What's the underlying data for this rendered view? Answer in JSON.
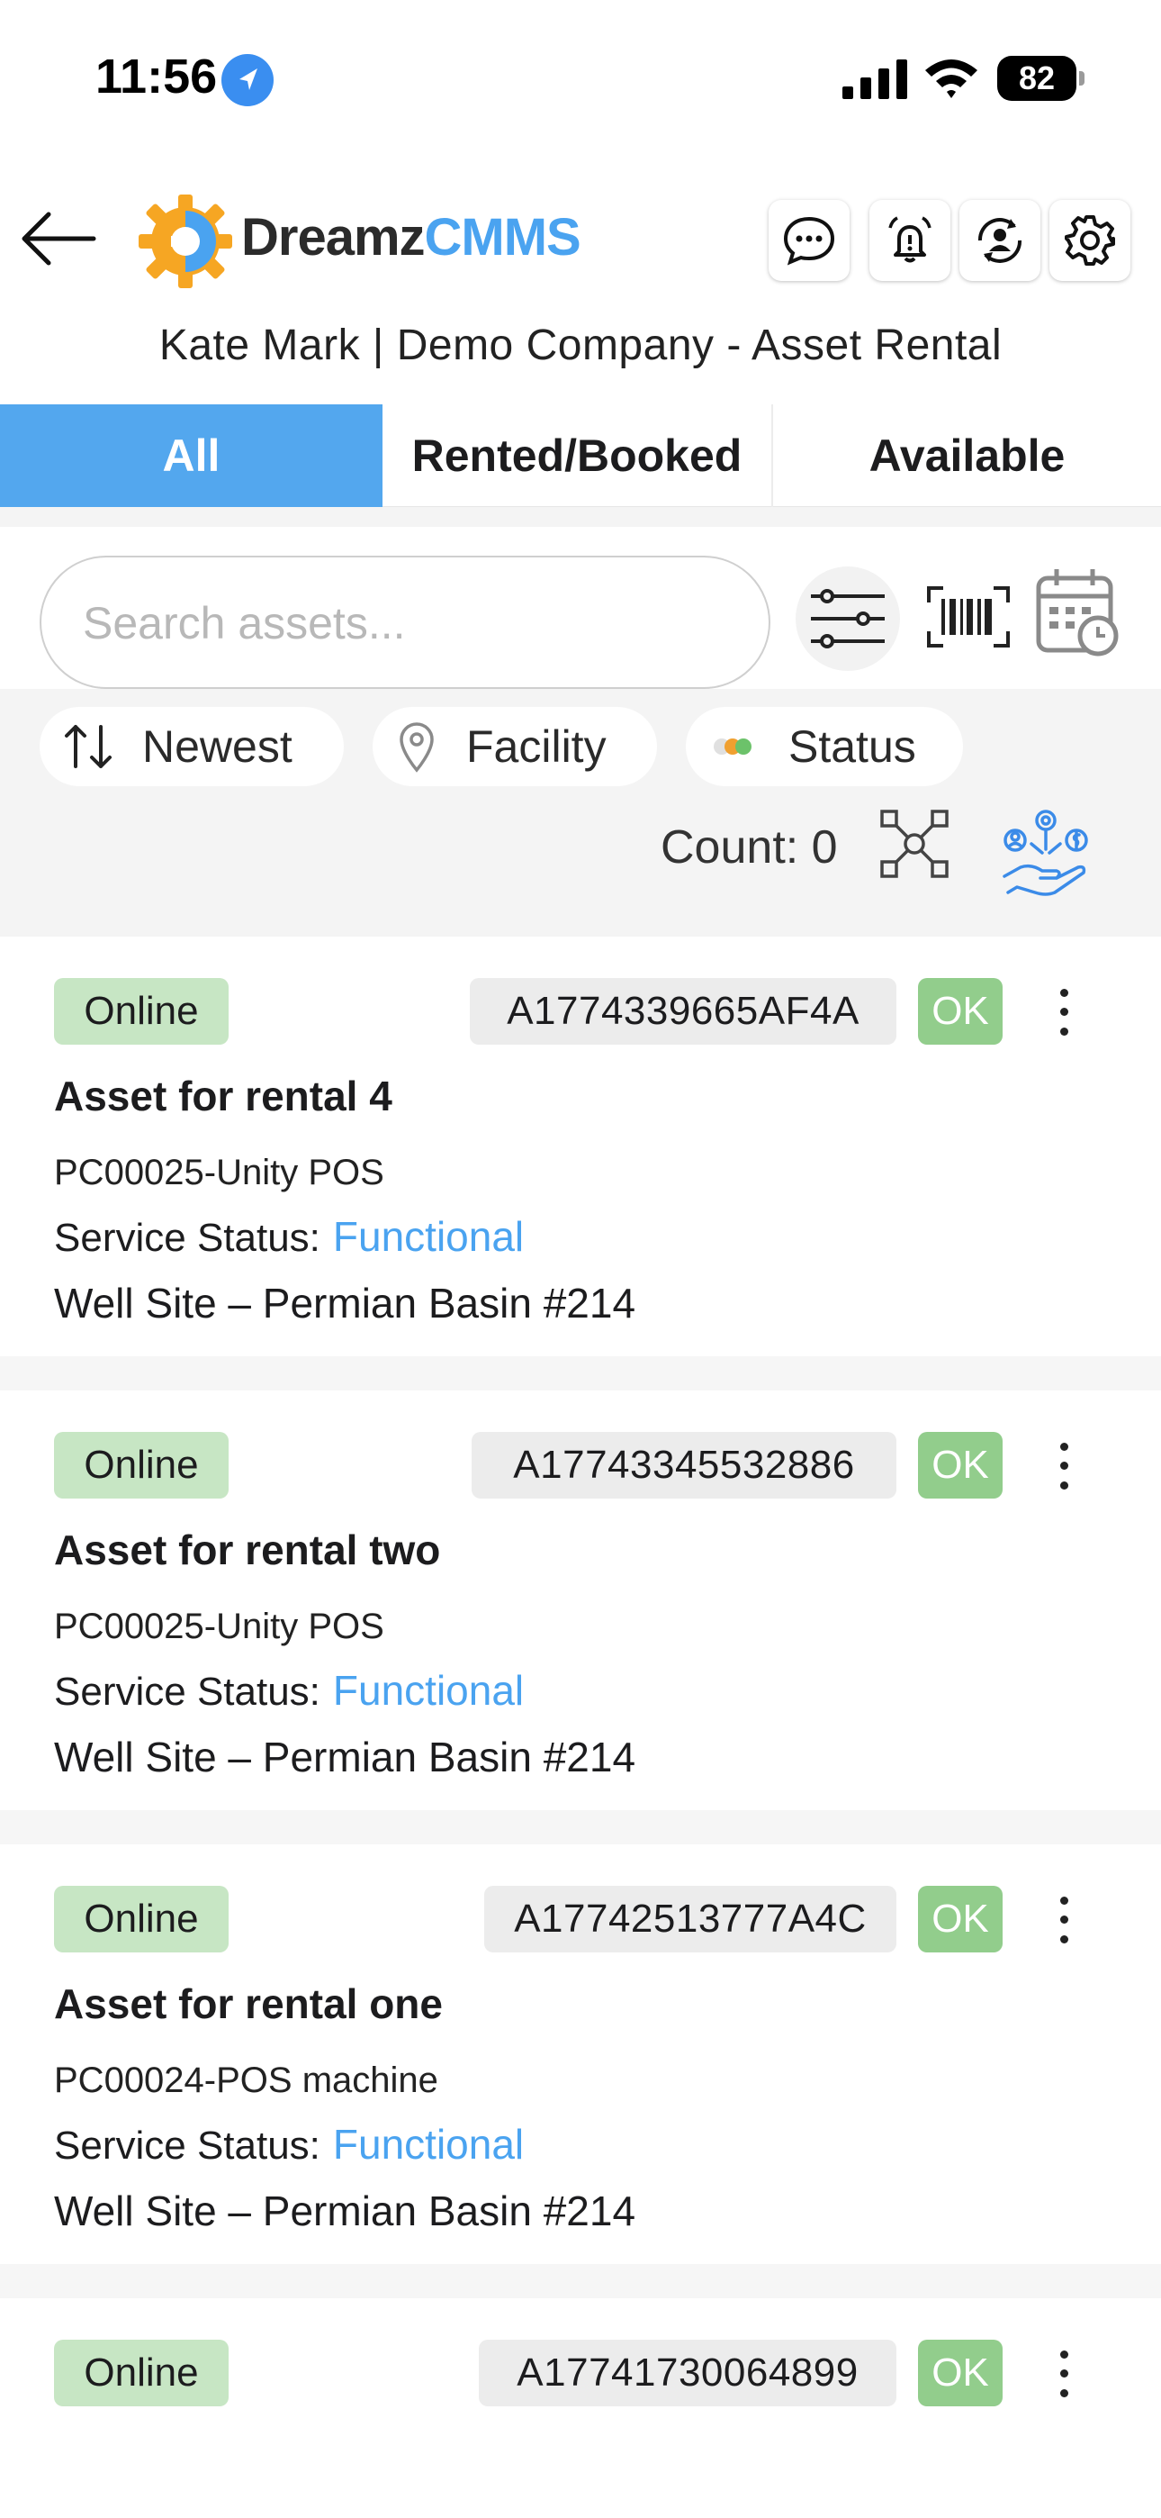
{
  "status_bar": {
    "time": "11:56",
    "battery": "82"
  },
  "header": {
    "logo_part1": "Dreamz",
    "logo_part2": "CMMS",
    "subtitle": "Kate Mark  |  Demo Company - Asset Rental",
    "icons": [
      "back-arrow-icon",
      "chat-icon",
      "alarm-bell-icon",
      "user-sync-icon",
      "gear-icon"
    ]
  },
  "tabs": [
    {
      "label": "All",
      "active": true
    },
    {
      "label": "Rented/Booked",
      "active": false
    },
    {
      "label": "Available",
      "active": false
    }
  ],
  "search": {
    "placeholder": "Search assets..."
  },
  "filters": {
    "sort": "Newest",
    "facility": "Facility",
    "status": "Status"
  },
  "count_label": "Count: 0",
  "colors": {
    "accent": "#53a7ee",
    "link_blue": "#4aa3f0",
    "online_bg": "#c7e6c4",
    "ok_bg": "#92cd8c"
  },
  "assets": [
    {
      "state": "Online",
      "code": "A1774339665AF4A",
      "health": "OK",
      "name": "Asset for rental 4",
      "model": "PC00025-Unity POS",
      "service_label": "Service Status:",
      "service_status": "Functional",
      "location": "Well Site – Permian Basin #214"
    },
    {
      "state": "Online",
      "code": "A17743345532886",
      "health": "OK",
      "name": "Asset for rental two",
      "model": "PC00025-Unity POS",
      "service_label": "Service Status:",
      "service_status": "Functional",
      "location": "Well Site – Permian Basin #214"
    },
    {
      "state": "Online",
      "code": "A17742513777A4C",
      "health": "OK",
      "name": "Asset for rental one",
      "model": "PC00024-POS machine",
      "service_label": "Service Status:",
      "service_status": "Functional",
      "location": "Well Site – Permian Basin #214"
    },
    {
      "state": "Online",
      "code": "A17741730064899",
      "health": "OK"
    }
  ]
}
